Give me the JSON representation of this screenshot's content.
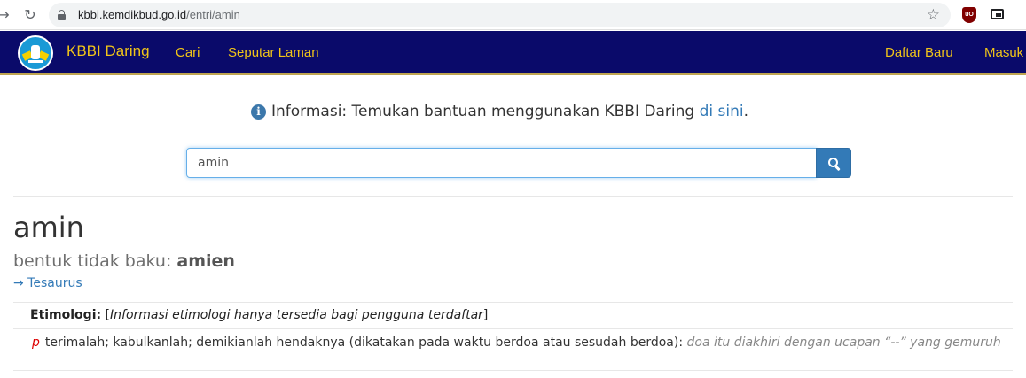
{
  "browser": {
    "url_host": "kbbi.kemdikbud.go.id",
    "url_path": "/entri/amin",
    "back_glyph": "→",
    "reload_glyph": "↻",
    "star_glyph": "☆",
    "ublock_text": "uO"
  },
  "navbar": {
    "brand": "KBBI Daring",
    "links": [
      "Cari",
      "Seputar Laman"
    ],
    "right_links": [
      "Daftar Baru",
      "Masuk"
    ],
    "bg_color": "#0a0a6a",
    "link_color": "#f0c419"
  },
  "info": {
    "icon_glyph": "i",
    "text": "Informasi: Temukan bantuan menggunakan KBBI Daring ",
    "link": "di sini",
    "suffix": "."
  },
  "search": {
    "value": "amin"
  },
  "entry": {
    "headword": "amin",
    "variant_label": "bentuk tidak baku: ",
    "variant_value": "amien",
    "thesaurus_link": "→ Tesaurus",
    "etimologi_label": "Etimologi:",
    "etimologi_open": " [",
    "etimologi_value": "Informasi etimologi hanya tersedia bagi pengguna terdaftar",
    "etimologi_close": "]",
    "sense": {
      "pos": "p",
      "definition": "terimalah; kabulkanlah; demikianlah hendaknya (dikatakan pada waktu berdoa atau sesudah berdoa): ",
      "example": "doa itu diakhiri dengan ucapan “--” yang gemuruh"
    }
  }
}
